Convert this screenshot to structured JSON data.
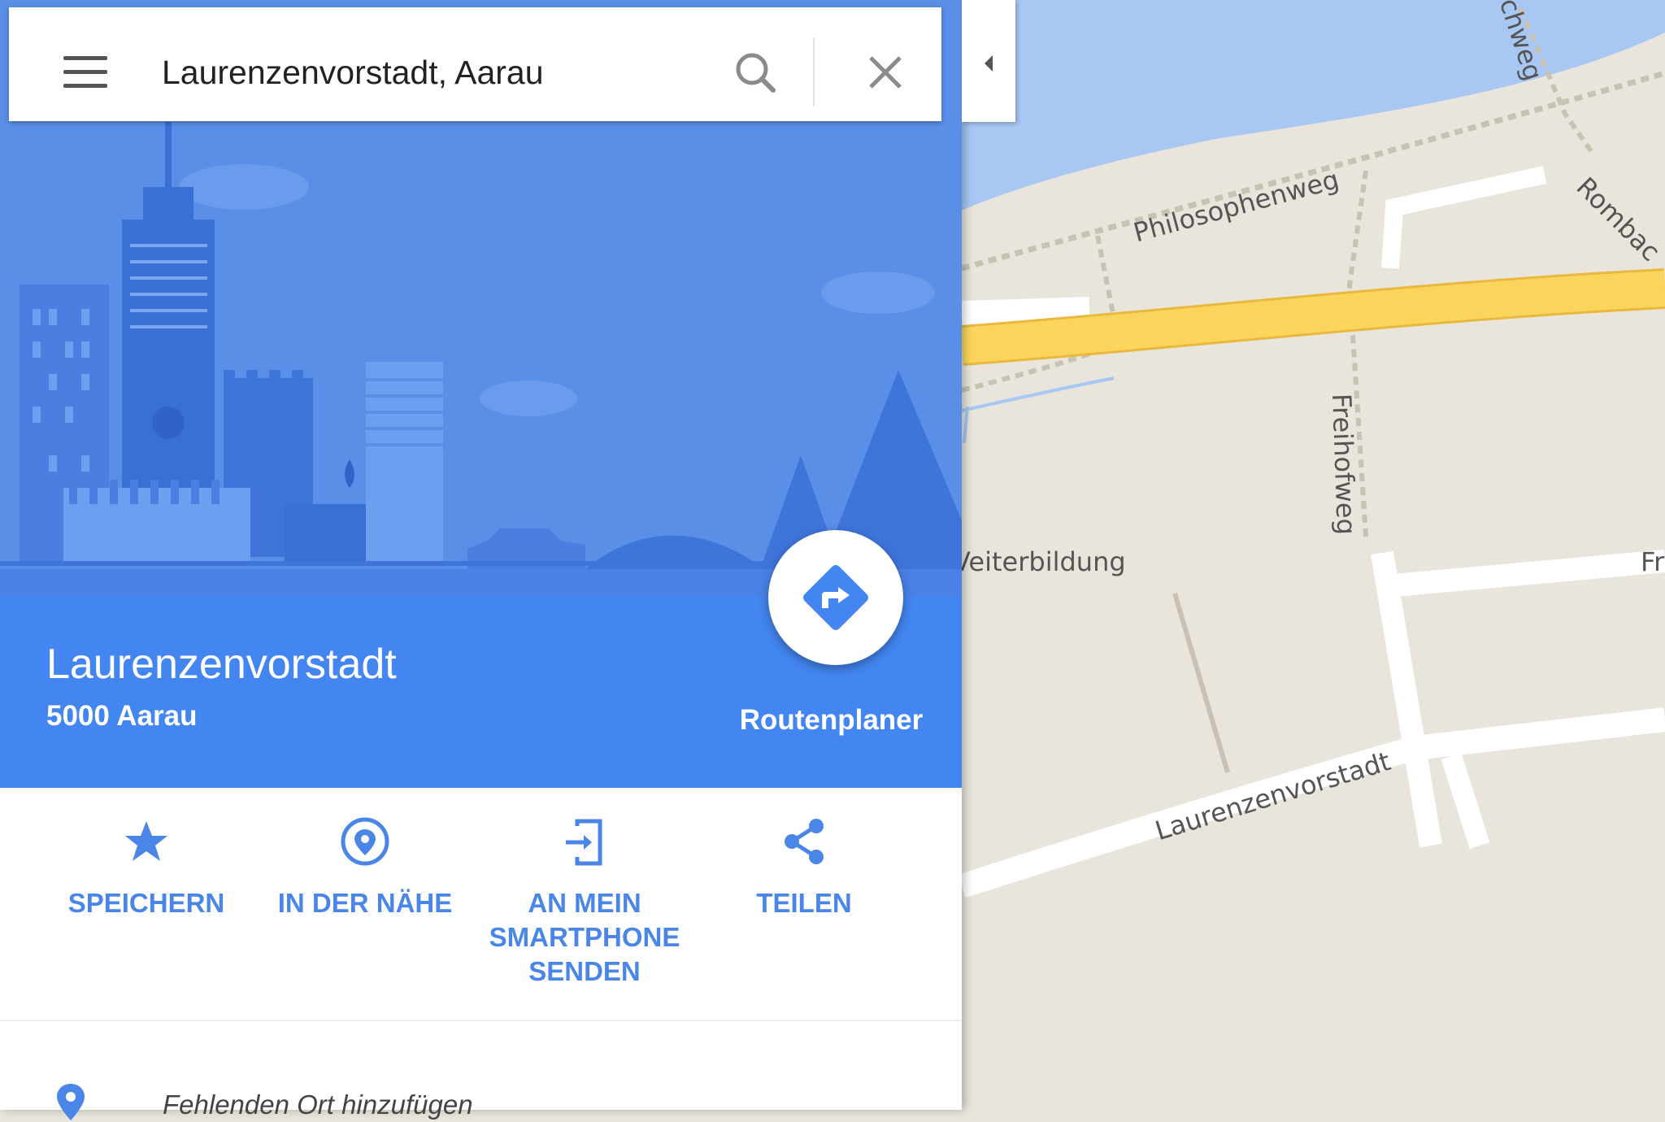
{
  "search": {
    "value": "Laurenzenvorstadt, Aarau"
  },
  "place": {
    "title": "Laurenzenvorstadt",
    "subtitle": "5000 Aarau",
    "route_label": "Routenplaner"
  },
  "actions": [
    {
      "label_lines": [
        "SPEICHERN"
      ],
      "icon": "star-icon"
    },
    {
      "label_lines": [
        "IN DER NÄHE"
      ],
      "icon": "nearby-pin-icon"
    },
    {
      "label_lines": [
        "AN MEIN",
        "SMARTPHONE",
        "SENDEN"
      ],
      "icon": "send-to-phone-icon"
    },
    {
      "label_lines": [
        "TEILEN"
      ],
      "icon": "share-icon"
    }
  ],
  "missing_place": {
    "label": "Fehlenden Ort hinzufügen",
    "icon": "pin-icon"
  },
  "map": {
    "labels": {
      "philosophenweg": "Philosophenweg",
      "rombach": "Rombac",
      "chweg": "chweg",
      "freihofweg": "Freihofweg",
      "weiterbildung": "Veiterbildung",
      "fr": "Fr",
      "laurenzenvorstadt": "Laurenzenvorstadt"
    }
  },
  "colors": {
    "accent": "#4386f1",
    "hero": "#5a8fe8",
    "action_text": "#4a86e8",
    "water": "#a8c7f3",
    "land": "#e9e5dc",
    "highway": "#fbd55b"
  }
}
